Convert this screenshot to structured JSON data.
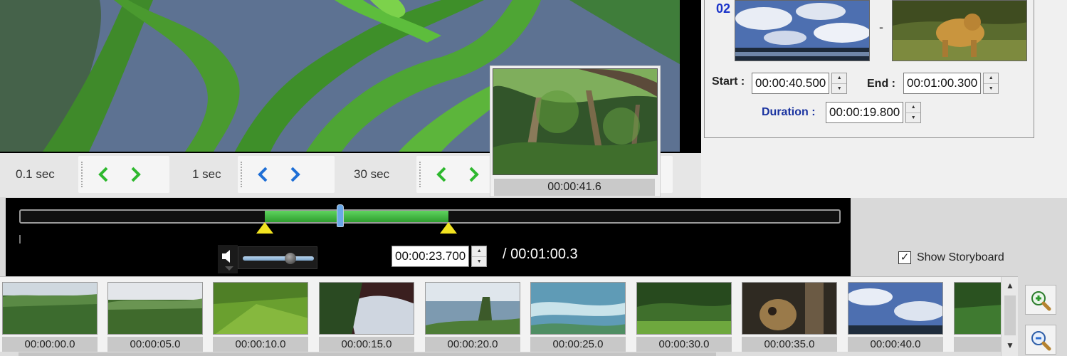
{
  "step_controls": [
    {
      "label": "0.1 sec",
      "color": "#2eb82e"
    },
    {
      "label": "1 sec",
      "color": "#1f6fd6"
    },
    {
      "label": "30 sec",
      "color": "#2eb82e"
    }
  ],
  "preview_popup": {
    "time": "00:00:41.6"
  },
  "clip": {
    "number": "02",
    "separator": "-",
    "start_label": "Start",
    "start_value": "00:00:40.500",
    "end_label": "End",
    "end_value": "00:01:00.300",
    "duration_label": "Duration",
    "duration_value": "00:00:19.800",
    "colon": ":"
  },
  "timeline": {
    "current_time": "00:00:23.700",
    "total_time": "/ 00:01:00.3",
    "selection_color": "#3cb83c",
    "volume_level": 0.7
  },
  "show_storyboard": {
    "label": "Show Storyboard",
    "checked": true,
    "check_mark": "✓"
  },
  "storyboard": {
    "frames": [
      {
        "time": "00:00:00.0"
      },
      {
        "time": "00:00:05.0"
      },
      {
        "time": "00:00:10.0"
      },
      {
        "time": "00:00:15.0"
      },
      {
        "time": "00:00:20.0"
      },
      {
        "time": "00:00:25.0"
      },
      {
        "time": "00:00:30.0"
      },
      {
        "time": "00:00:35.0"
      },
      {
        "time": "00:00:40.0"
      },
      {
        "time": ""
      }
    ],
    "scroll_up": "▲",
    "scroll_down": "▼"
  },
  "icons": {
    "zoom_in": "zoom-in-icon",
    "zoom_out": "zoom-out-icon",
    "volume": "speaker-icon"
  }
}
